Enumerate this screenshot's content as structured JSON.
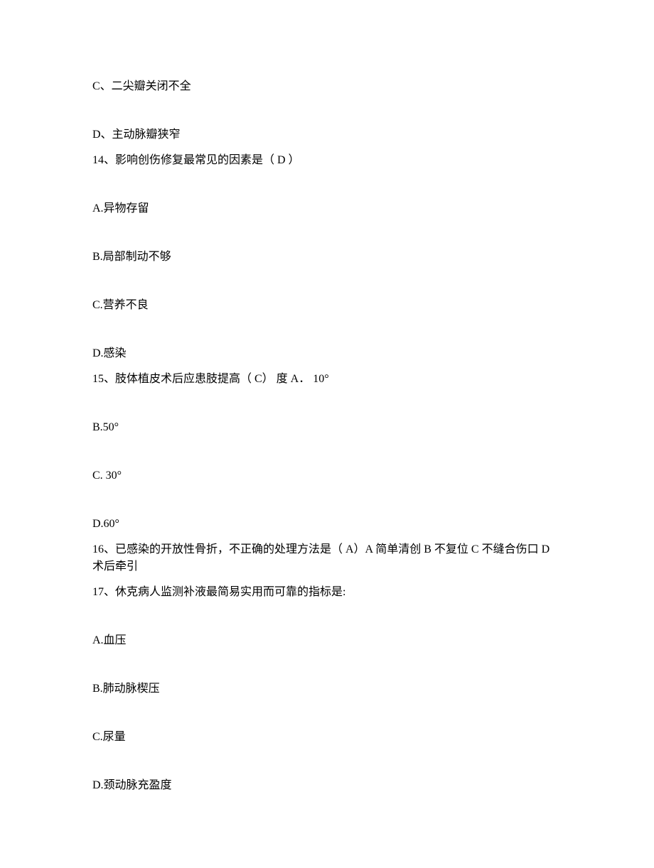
{
  "lines": {
    "l1": "C、二尖瓣关闭不全",
    "l2": "D、主动脉瓣狭窄",
    "l3": "14、影响创伤修复最常见的因素是（ D ）",
    "l4": "A.异物存留",
    "l5": "B.局部制动不够",
    "l6": "C.营养不良",
    "l7": "D.感染",
    "l8": "15、肢体植皮术后应患肢提高（ C） 度 A． 10°",
    "l9": "B.50°",
    "l10": "C. 30°",
    "l11": "D.60°",
    "l12": "16、已感染的开放性骨折，不正确的处理方法是（ A）A 简单清创     B 不复位   C 不缝合伤口     D 术后牵引",
    "l13": "17、休克病人监测补液最简易实用而可靠的指标是:",
    "l14": "A.血压",
    "l15": "B.肺动脉楔压",
    "l16": "C.尿量",
    "l17": "D.颈动脉充盈度"
  }
}
